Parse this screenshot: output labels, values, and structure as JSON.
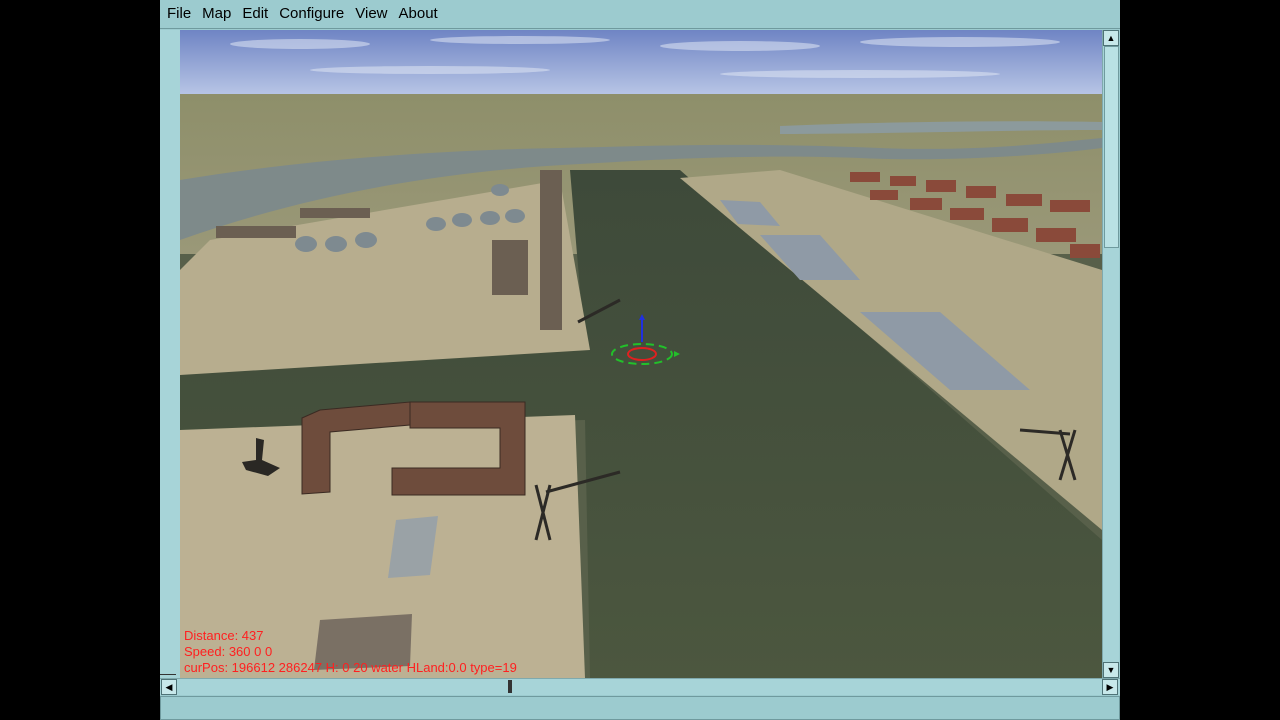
{
  "menu": {
    "items": [
      "File",
      "Map",
      "Edit",
      "Configure",
      "View",
      "About"
    ]
  },
  "overlay": {
    "distance": "Distance: 437",
    "speed": "Speed: 360 0 0",
    "position": "curPos: 196612 286247 H: 0 20 water HLand:0.0 type=19"
  },
  "status": {
    "text": ""
  },
  "colors": {
    "window_bg": "#9ccbcf",
    "overlay_text": "#ff2020",
    "water": "#4f5a42"
  },
  "icons": {
    "scroll_up": "triangle-up-icon",
    "scroll_down": "triangle-down-icon",
    "scroll_left": "triangle-left-icon",
    "scroll_right": "triangle-right-icon"
  }
}
